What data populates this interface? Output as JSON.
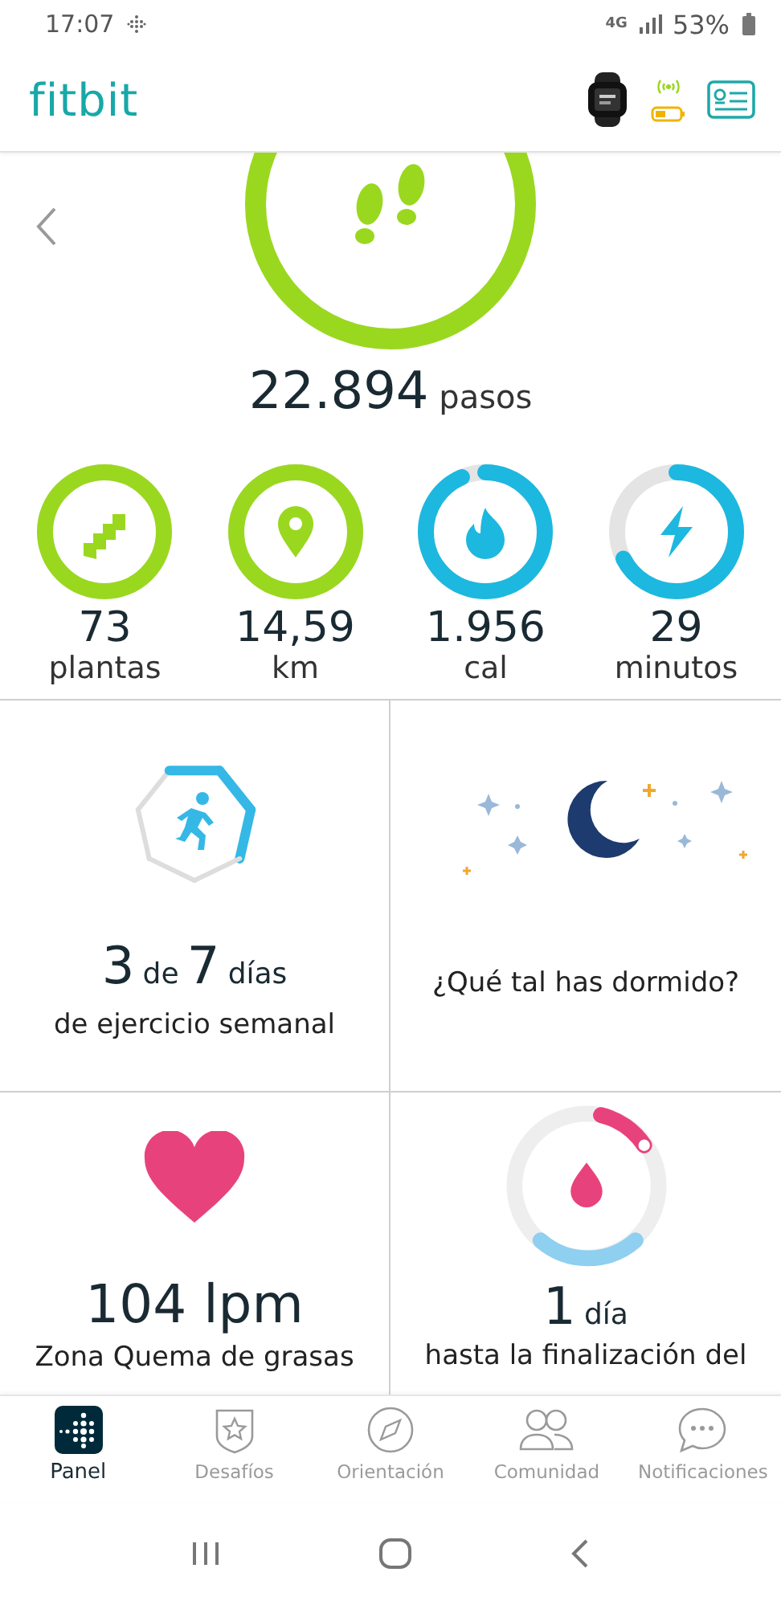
{
  "status_bar": {
    "time": "17:07",
    "network": "4G",
    "battery": "53%"
  },
  "header": {
    "logo": "fitbit"
  },
  "steps": {
    "value": "22.894",
    "unit": "pasos"
  },
  "stats": [
    {
      "kind": "floors",
      "value": "73",
      "label": "plantas",
      "level": 1,
      "color": "#9ad81f"
    },
    {
      "kind": "distance",
      "value": "14,59",
      "label": "km",
      "level": 1,
      "color": "#9ad81f"
    },
    {
      "kind": "calories",
      "value": "1.956",
      "label": "cal",
      "level": 0.96,
      "color": "#1cb8df"
    },
    {
      "kind": "minutes",
      "value": "29",
      "label": "minutos",
      "level": 0.7,
      "color": "#1cb8df"
    }
  ],
  "tiles": [
    {
      "kind": "exercise",
      "count_parts": [
        {
          "text": "3",
          "kind": "number"
        },
        {
          "text": "de",
          "kind": "word"
        },
        {
          "text": "7",
          "kind": "number"
        },
        {
          "text": "días",
          "kind": "word"
        }
      ],
      "caption": "de ejercicio semanal"
    },
    {
      "kind": "sleep",
      "caption": "¿Qué tal has dormido?"
    },
    {
      "kind": "heart",
      "value": "104 lpm",
      "caption": "Zona Quema de grasas"
    },
    {
      "kind": "cycle",
      "count_parts": [
        {
          "text": "1",
          "kind": "number"
        },
        {
          "text": "día",
          "kind": "word"
        }
      ],
      "caption": "hasta la finalización del"
    }
  ],
  "nav": [
    {
      "kind": "dashboard",
      "label": "Panel",
      "selected": true
    },
    {
      "kind": "challenges",
      "label": "Desafíos",
      "selected": false
    },
    {
      "kind": "discover",
      "label": "Orientación",
      "selected": false
    },
    {
      "kind": "community",
      "label": "Comunidad",
      "selected": false
    },
    {
      "kind": "notifications",
      "label": "Notificaciones",
      "selected": false
    }
  ]
}
